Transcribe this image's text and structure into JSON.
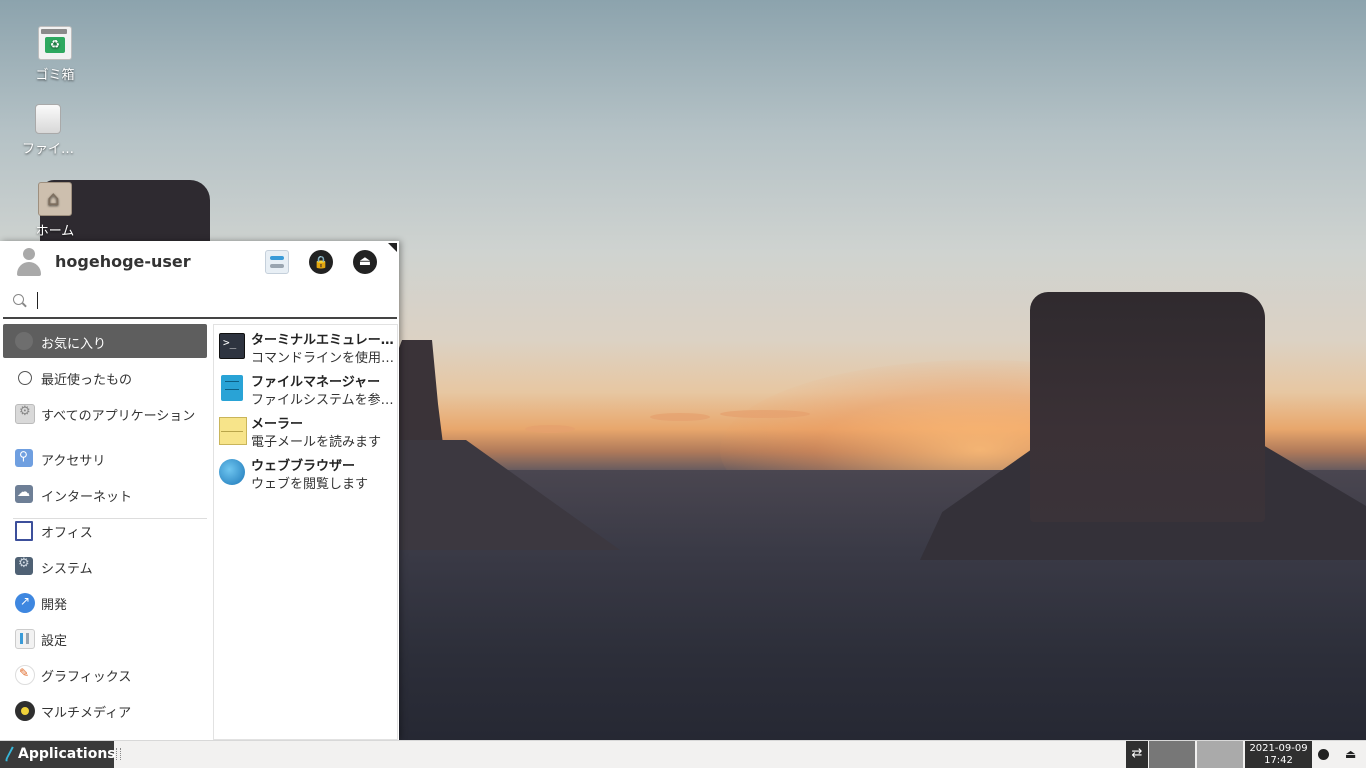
{
  "desktop": {
    "icons": [
      {
        "label": "ゴミ箱",
        "icon": "trash-icon"
      },
      {
        "label": "ファイ…",
        "icon": "disk-icon"
      },
      {
        "label": "ホーム",
        "icon": "home-folder-icon"
      }
    ]
  },
  "menu": {
    "username": "hogehoge-user",
    "search": {
      "value": "",
      "placeholder": ""
    },
    "header_buttons": [
      {
        "name": "settings-manager",
        "icon": "settings-toggle-icon"
      },
      {
        "name": "lock-screen",
        "icon": "lock-icon",
        "glyph": "🔒"
      },
      {
        "name": "logout",
        "icon": "logout-icon",
        "glyph": "⏏"
      }
    ],
    "categories": [
      {
        "label": "お気に入り",
        "icon": "favorites-icon",
        "active": true
      },
      {
        "label": "最近使ったもの",
        "icon": "recent-icon"
      },
      {
        "label": "すべてのアプリケーション",
        "icon": "all-apps-icon"
      },
      {
        "label": "アクセサリ",
        "icon": "accessories-icon"
      },
      {
        "label": "インターネット",
        "icon": "internet-icon"
      },
      {
        "label": "オフィス",
        "icon": "office-icon"
      },
      {
        "label": "システム",
        "icon": "system-icon"
      },
      {
        "label": "開発",
        "icon": "development-icon"
      },
      {
        "label": "設定",
        "icon": "settings-icon"
      },
      {
        "label": "グラフィックス",
        "icon": "graphics-icon"
      },
      {
        "label": "マルチメディア",
        "icon": "multimedia-icon"
      }
    ],
    "apps": [
      {
        "name": "ターミナルエミュレー…",
        "desc": "コマンドラインを使用…",
        "icon": "terminal-icon",
        "glyph": ">_"
      },
      {
        "name": "ファイルマネージャー",
        "desc": "ファイルシステムを参…",
        "icon": "file-manager-icon"
      },
      {
        "name": "メーラー",
        "desc": "電子メールを読みます",
        "icon": "mail-icon"
      },
      {
        "name": "ウェブブラウザー",
        "desc": "ウェブを閲覧します",
        "icon": "web-browser-icon"
      }
    ]
  },
  "panel": {
    "apps_button": "Applications",
    "clock_date": "2021-09-09",
    "clock_time": "17:42"
  }
}
